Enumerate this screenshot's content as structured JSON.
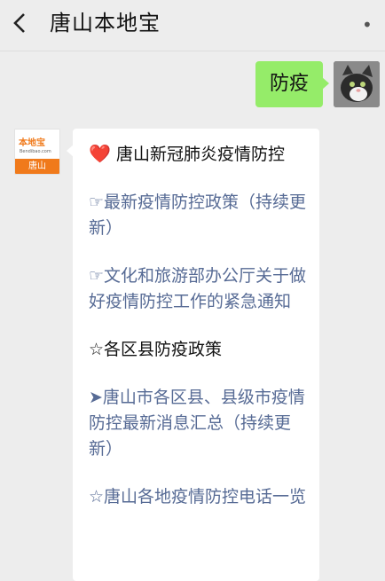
{
  "header": {
    "back_glyph": "<",
    "title": "唐山本地宝",
    "more_glyph": "•"
  },
  "me": {
    "message": "防疫",
    "avatar_icon": "cat-photo-avatar"
  },
  "other": {
    "avatar": {
      "brand": "本地宝",
      "site": "Bendibao.com",
      "city": "唐山"
    },
    "heart_icon": "heart-icon",
    "lines": {
      "heading_prefix": "❤️",
      "heading": "唐山新冠肺炎疫情防控",
      "policy_link": "☞最新疫情防控政策（持续更新）",
      "culture_link": "☞文化和旅游部办公厅关于做好疫情防控工作的紧急通知",
      "district_heading": "☆各区县防疫政策",
      "district_link": "➤唐山市各区县、县级市疫情防控最新消息汇总（持续更新）",
      "phone_link": "☆唐山各地疫情防控电话一览"
    }
  },
  "colors": {
    "background": "#ededed",
    "my_bubble": "#95ec69",
    "link": "#576b95",
    "brand_orange": "#f07a1b"
  }
}
